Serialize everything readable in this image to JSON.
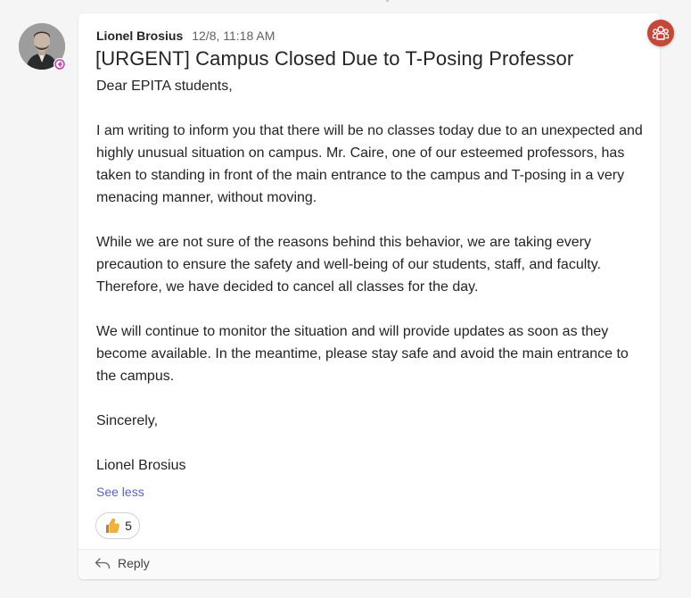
{
  "message": {
    "author": "Lionel Brosius",
    "timestamp": "12/8, 11:18 AM",
    "title": "[URGENT] Campus Closed Due to T-Posing Professor",
    "paragraphs": [
      "Dear EPITA students,",
      "I am writing to inform you that there will be no classes today due to an unexpected and highly unusual situation on campus. Mr. Caire, one of our esteemed professors, has taken to standing in front of the main entrance to the campus and T-posing in a very menacing manner, without moving.",
      "While we are not sure of the reasons behind this behavior, we are taking every precaution to ensure the safety and well-being of our students, staff, and faculty. Therefore, we have decided to cancel all classes for the day.",
      "We will continue to monitor the situation and will provide updates as soon as they become available. In the meantime, please stay safe and avoid the main entrance to the campus.",
      "Sincerely,",
      "Lionel Brosius"
    ],
    "see_less_label": "See less",
    "reaction": {
      "icon": "thumbs-up-icon",
      "count": "5"
    },
    "reply_label": "Reply"
  },
  "icons": {
    "avatar": "avatar",
    "presence": "presence-away-icon",
    "group_badge": "group-people-icon",
    "reply": "reply-arrow-icon"
  },
  "colors": {
    "link": "#5b5fc7",
    "badge": "#c4483a",
    "presence": "#c239b3",
    "reaction": "#e8a33d"
  }
}
